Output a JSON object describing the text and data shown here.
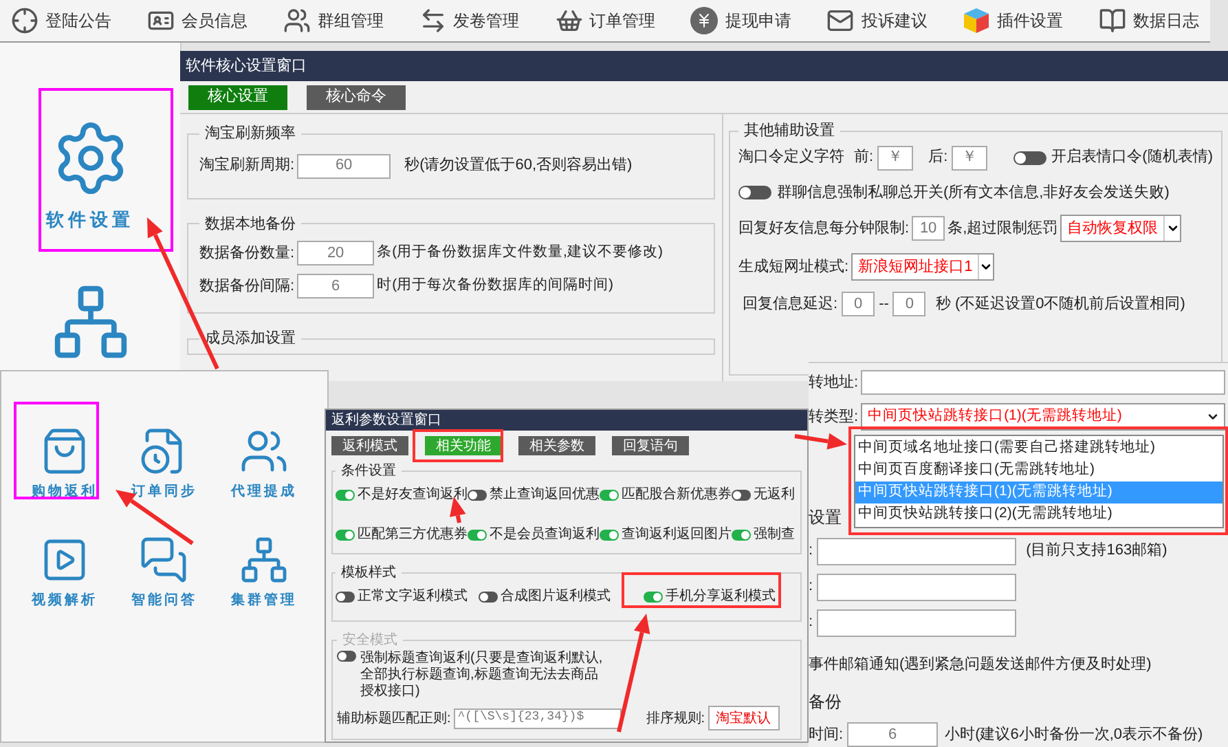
{
  "nav": [
    {
      "label": "登陆公告",
      "kind": "crosshair"
    },
    {
      "label": "会员信息",
      "kind": "card"
    },
    {
      "label": "群组管理",
      "kind": "users"
    },
    {
      "label": "发卷管理",
      "kind": "swap"
    },
    {
      "label": "订单管理",
      "kind": "basket"
    },
    {
      "label": "提现申请",
      "kind": "coin"
    },
    {
      "label": "投诉建议",
      "kind": "mail"
    },
    {
      "label": "插件设置",
      "kind": "cube"
    },
    {
      "label": "数据日志",
      "kind": "book"
    }
  ],
  "side_panel": {
    "items": [
      {
        "label": "软件设置",
        "kind": "gear"
      },
      {
        "kind": "network"
      }
    ]
  },
  "settings_window": {
    "title": "软件核心设置窗口",
    "tabs": [
      {
        "label": "核心设置",
        "selected": true
      },
      {
        "label": "核心命令",
        "selected": false
      }
    ],
    "refresh": {
      "title": "淘宝刷新频率",
      "label": "淘宝刷新周期:",
      "value": "60",
      "hint": "秒(请勿设置低于60,否则容易出错)"
    },
    "backup": {
      "title": "数据本地备份",
      "rows": [
        {
          "label": "数据备份数量:",
          "value": "20",
          "hint": "条(用于备份数据库文件数量,建议不要修改)"
        },
        {
          "label": "数据备份间隔:",
          "value": "6",
          "hint": "时(用于每次备份数据库的间隔时间)"
        }
      ]
    },
    "member": {
      "title": "成员添加设置"
    },
    "other": {
      "title": "其他辅助设置",
      "token_label": "淘口令定义字符",
      "before_label": "前:",
      "before": "￥",
      "after_label": "后:",
      "after": "￥",
      "emoji_toggle": {
        "label": "开启表情口令(随机表情)",
        "on": false
      },
      "private_toggle": {
        "label": "群聊信息强制私聊总开关(所有文本信息,非好友会发送失败)",
        "on": false
      },
      "limit_label": "回复好友信息每分钟限制:",
      "limit": "10",
      "limit_hint": "条,超过限制惩罚",
      "penalty": "自动恢复权限",
      "short_label": "生成短网址模式:",
      "short": "新浪短网址接口1",
      "delay_label": "回复信息延迟:",
      "delay_from": "0",
      "delay_sep": "--",
      "delay_to": "0",
      "delay_hint": "秒 (不延迟设置0不随机前后设置相同)"
    }
  },
  "menu_panel": {
    "items": [
      {
        "label": "购物返利",
        "kind": "bag"
      },
      {
        "label": "订单同步",
        "kind": "order"
      },
      {
        "label": "代理提成",
        "kind": "users"
      },
      {
        "label": "视频解析",
        "kind": "play"
      },
      {
        "label": "智能问答",
        "kind": "chat"
      },
      {
        "label": "集群管理",
        "kind": "network"
      }
    ]
  },
  "rebate_window": {
    "title": "返利参数设置窗口",
    "tabs": [
      {
        "label": "返利模式",
        "selected": false
      },
      {
        "label": "相关功能",
        "selected": true
      },
      {
        "label": "相关参数",
        "selected": false
      },
      {
        "label": "回复语句",
        "selected": false
      }
    ],
    "conditions": {
      "title": "条件设置",
      "toggles": [
        {
          "label": "不是好友查询返利",
          "on": true
        },
        {
          "label": "禁止查询返回优惠",
          "on": false
        },
        {
          "label": "匹配股合新优惠券",
          "on": true
        },
        {
          "label": "无返利",
          "on": false
        },
        {
          "label": "匹配第三方优惠券",
          "on": true
        },
        {
          "label": "不是会员查询返利",
          "on": true
        },
        {
          "label": "查询返利返回图片",
          "on": true
        },
        {
          "label": "强制查",
          "on": true
        }
      ]
    },
    "templates": {
      "title": "模板样式",
      "toggles": [
        {
          "label": "正常文字返利模式",
          "on": false
        },
        {
          "label": "合成图片返利模式",
          "on": false
        },
        {
          "label": "手机分享返利模式",
          "on": true
        }
      ]
    },
    "safe": {
      "title": "安全模式",
      "disabled": true,
      "toggle": {
        "label": "强制标题查询返利(只要是查询返利默认,全部执行标题查询,标题查询无法去商品授权接口)",
        "on": false
      },
      "regex_label": "辅助标题匹配正则:",
      "regex": "^([\\S\\s]{23,34})$",
      "sort_label": "排序规则:",
      "sort": "淘宝默认"
    }
  },
  "redirect_panel": {
    "address_label": "转地址:",
    "type_label": "转类型:",
    "type": "中间页快站跳转接口(1)(无需跳转地址)",
    "options": [
      {
        "label": "中间页域名地址接口(需要自己搭建跳转地址)",
        "selected": false
      },
      {
        "label": "中间页百度翻译接口(无需跳转地址)",
        "selected": false
      },
      {
        "label": "中间页快站跳转接口(1)(无需跳转地址)",
        "selected": true
      },
      {
        "label": "中间页快站跳转接口(2)(无需跳转地址)",
        "selected": false
      }
    ],
    "mail_title": "设置",
    "mail_fields": [
      {
        "label": ":",
        "hint": "(目前只支持163邮箱)"
      },
      {
        "label": ":"
      },
      {
        "label": ":"
      }
    ],
    "mail_notice": "事件邮箱通知(遇到紧急问题发送邮件方便及时处理)",
    "backup_title": "备份",
    "backup_label": "时间:",
    "backup_value": "6",
    "backup_hint": "小时(建议6小时备份一次,0表示不备份)"
  }
}
